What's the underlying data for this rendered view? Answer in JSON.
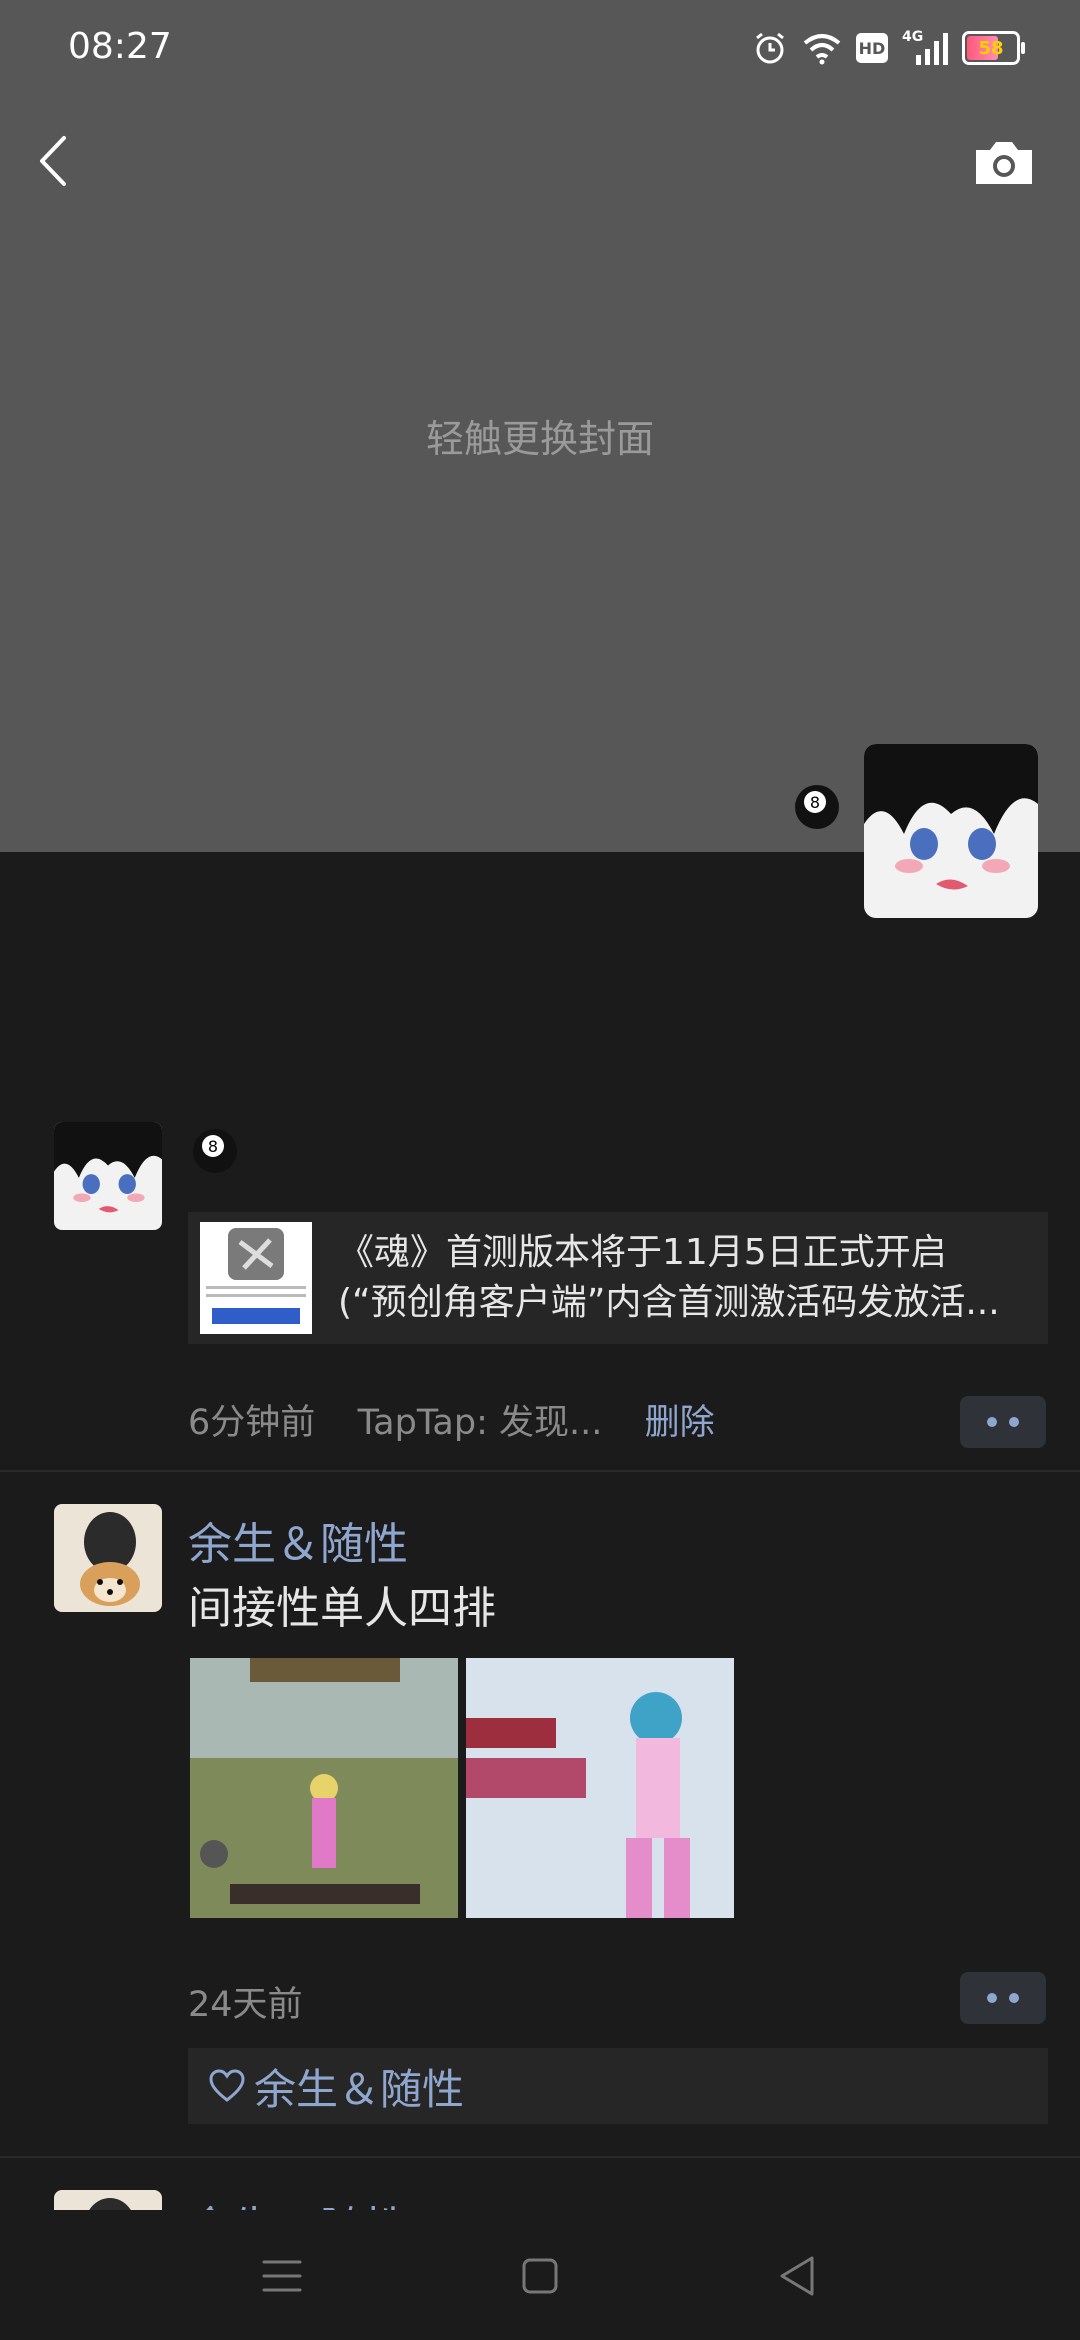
{
  "status_bar": {
    "time": "08:27",
    "battery": "58",
    "network": "4G",
    "hd_label": "HD"
  },
  "cover": {
    "hint": "轻触更换封面"
  },
  "posts": [
    {
      "link": {
        "line1": "《魂》首测版本将于11月5日正式开启",
        "line2": "(“预创角客户端”内含首测激活码发放活..."
      },
      "time": "6分钟前",
      "source": "TapTap: 发现...",
      "delete_label": "删除"
    },
    {
      "username": "余生＆随性",
      "text": "间接性单人四排",
      "time": "24天前",
      "likes": [
        "余生＆随性"
      ]
    },
    {
      "username": "余生＆随性"
    }
  ],
  "colors": {
    "link_blue": "#8fa6cf",
    "cover_gray": "#575757",
    "background": "#1b1b1b"
  }
}
